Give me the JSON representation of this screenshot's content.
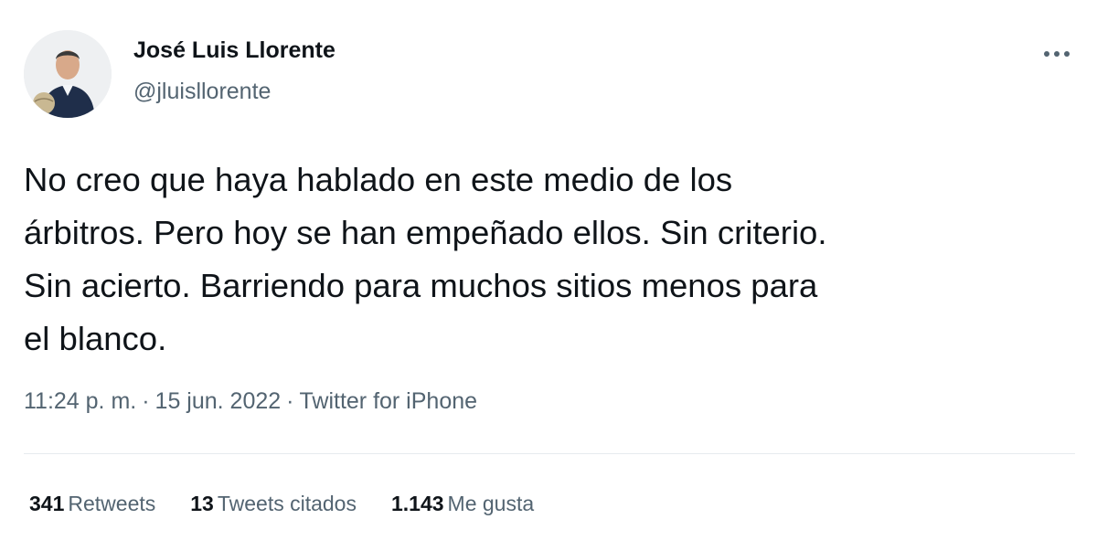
{
  "author": {
    "name": "José Luis Llorente",
    "handle": "@jluisllorente"
  },
  "tweet": {
    "text": "No creo que haya hablado en este medio de los\nárbitros. Pero hoy se han empeñado ellos. Sin criterio.\nSin acierto. Barriendo para muchos sitios menos para\nel blanco."
  },
  "meta": {
    "time": "11:24 p. m.",
    "separator": "·",
    "date": "15 jun. 2022",
    "source": "Twitter for iPhone"
  },
  "stats": {
    "retweets": {
      "count": "341",
      "label": "Retweets"
    },
    "quotes": {
      "count": "13",
      "label": "Tweets citados"
    },
    "likes": {
      "count": "1.143",
      "label": "Me gusta"
    }
  },
  "icons": {
    "more": "more-horizontal-icon"
  },
  "colors": {
    "text_primary": "#0f1419",
    "text_secondary": "#536471",
    "divider": "#e6ebee"
  }
}
